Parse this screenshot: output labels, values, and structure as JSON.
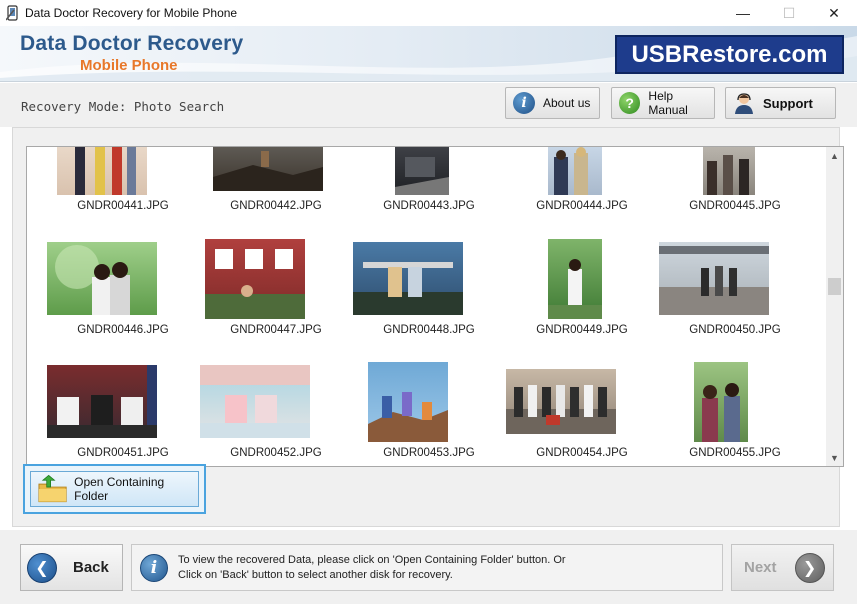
{
  "window": {
    "title": "Data Doctor Recovery for Mobile Phone",
    "minimize_glyph": "—",
    "maximize_glyph": "☐",
    "close_glyph": "✕"
  },
  "banner": {
    "brand_line1": "Data Doctor Recovery",
    "brand_line2": "Mobile Phone",
    "logo_text": "USBRestore.com",
    "brand_color": "#2d5a8c",
    "accent_color": "#e8782a",
    "logo_bg": "#1e3c8c"
  },
  "toolbar": {
    "mode_label": "Recovery Mode: Photo Search",
    "about_label": "About us",
    "about_icon": "info-icon",
    "help_label": "Help Manual",
    "help_icon": "question-icon",
    "support_label": "Support",
    "support_icon": "support-agent-icon"
  },
  "gallery": {
    "items": [
      {
        "file": "GNDR00441.JPG"
      },
      {
        "file": "GNDR00442.JPG"
      },
      {
        "file": "GNDR00443.JPG"
      },
      {
        "file": "GNDR00444.JPG"
      },
      {
        "file": "GNDR00445.JPG"
      },
      {
        "file": "GNDR00446.JPG"
      },
      {
        "file": "GNDR00447.JPG"
      },
      {
        "file": "GNDR00448.JPG"
      },
      {
        "file": "GNDR00449.JPG"
      },
      {
        "file": "GNDR00450.JPG"
      },
      {
        "file": "GNDR00451.JPG"
      },
      {
        "file": "GNDR00452.JPG"
      },
      {
        "file": "GNDR00453.JPG"
      },
      {
        "file": "GNDR00454.JPG"
      },
      {
        "file": "GNDR00455.JPG"
      }
    ]
  },
  "actions": {
    "open_folder_label": "Open Containing Folder",
    "back_label": "Back",
    "next_label": "Next"
  },
  "info": {
    "line1": "To view the recovered Data, please click on 'Open Containing Folder' button. Or",
    "line2": "Click on 'Back' button to select another disk for recovery."
  }
}
